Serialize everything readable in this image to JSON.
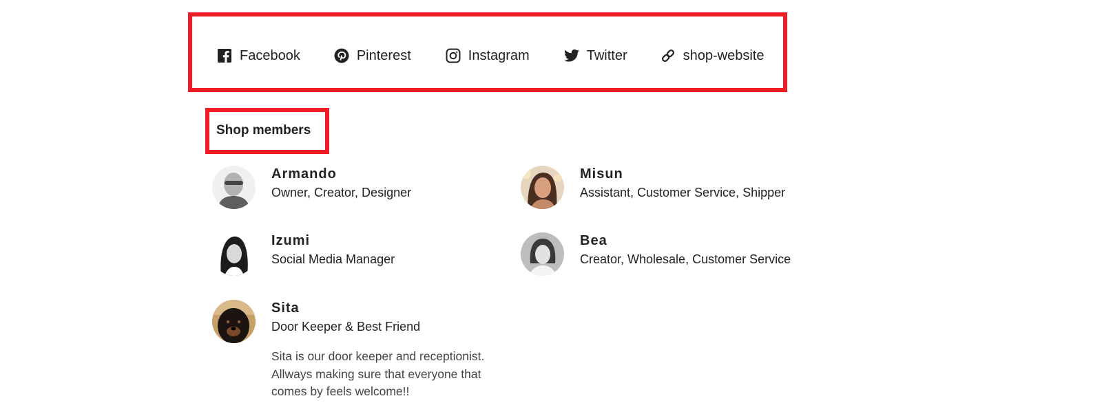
{
  "social": {
    "links": [
      {
        "label": "Facebook",
        "icon": "facebook-icon"
      },
      {
        "label": "Pinterest",
        "icon": "pinterest-icon"
      },
      {
        "label": "Instagram",
        "icon": "instagram-icon"
      },
      {
        "label": "Twitter",
        "icon": "twitter-icon"
      },
      {
        "label": "shop-website",
        "icon": "link-icon"
      }
    ]
  },
  "members_section": {
    "title": "Shop members",
    "members": [
      {
        "name": "Armando",
        "role": "Owner, Creator, Designer"
      },
      {
        "name": "Misun",
        "role": "Assistant, Customer Service, Shipper"
      },
      {
        "name": "Izumi",
        "role": "Social Media Manager"
      },
      {
        "name": "Bea",
        "role": "Creator, Wholesale, Customer Service"
      },
      {
        "name": "Sita",
        "role": "Door Keeper & Best Friend",
        "bio": "Sita is our door keeper and receptionist. Allways making sure that everyone that comes by feels welcome!!"
      }
    ]
  },
  "colors": {
    "highlight_border": "#ee1c25",
    "text": "#222222",
    "bio_text": "#444444"
  }
}
